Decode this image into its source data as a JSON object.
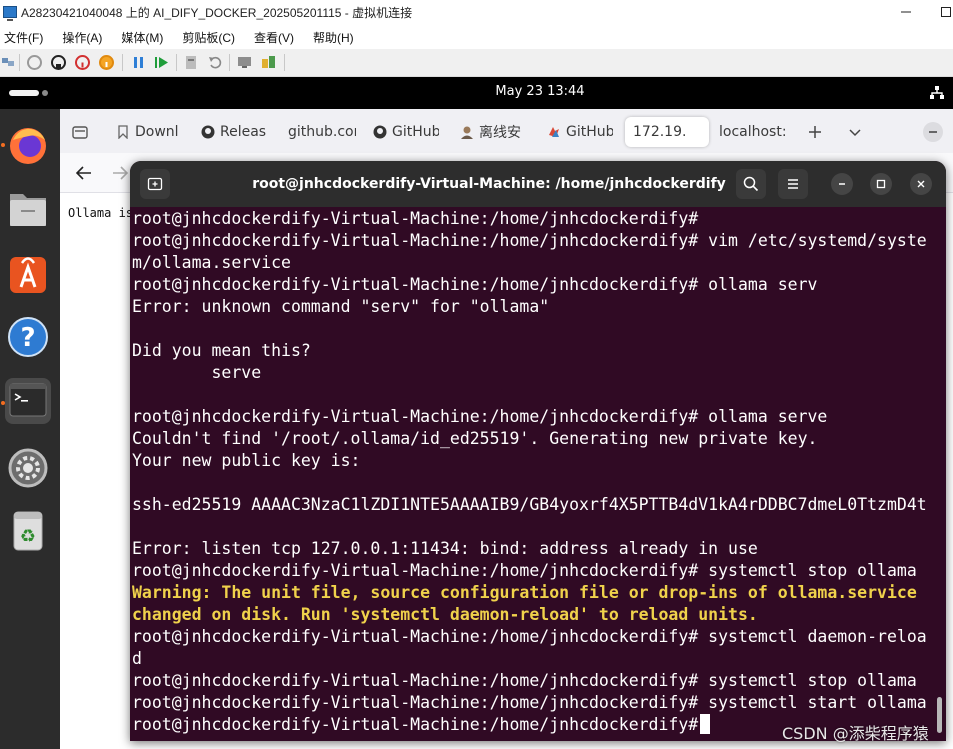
{
  "host_window": {
    "title": "A28230421040048 上的 AI_DIFY_DOCKER_202505201115 - 虚拟机连接",
    "menu": [
      "文件(F)",
      "操作(A)",
      "媒体(M)",
      "剪贴板(C)",
      "查看(V)",
      "帮助(H)"
    ],
    "toolbar_icons": [
      "ctrl-alt-del-icon",
      "start-icon",
      "turn-off-icon",
      "shutdown-icon",
      "power-icon",
      "pause-icon",
      "resume-icon",
      "checkpoint-icon",
      "revert-icon",
      "enhanced-session-icon",
      "share-icon"
    ]
  },
  "ubuntu_topbar": {
    "clock": "May 23  13:44"
  },
  "dock": {
    "apps": [
      "firefox-icon",
      "files-icon",
      "app-center-icon",
      "help-icon",
      "terminal-icon",
      "settings-icon",
      "trash-icon"
    ]
  },
  "firefox": {
    "tabs": [
      {
        "label": "Downl",
        "icon": "download-icon"
      },
      {
        "label": "Releas",
        "icon": "github-icon"
      },
      {
        "label": "github.cor",
        "icon": ""
      },
      {
        "label": "GitHub",
        "icon": "github-icon"
      },
      {
        "label": "离线安",
        "icon": "avatar-icon"
      },
      {
        "label": "GitHub",
        "icon": "gitee-icon"
      },
      {
        "label": "172.19.",
        "icon": ""
      },
      {
        "label": "localhost:",
        "icon": ""
      }
    ],
    "page_text": "Ollama is"
  },
  "terminal": {
    "title": "root@jnhcdockerdify-Virtual-Machine: /home/jnhcdockerdify",
    "lines": [
      {
        "text": "root@jnhcdockerdify-Virtual-Machine:/home/jnhcdockerdify#",
        "style": "normal"
      },
      {
        "text": "root@jnhcdockerdify-Virtual-Machine:/home/jnhcdockerdify# vim /etc/systemd/syste",
        "style": "normal"
      },
      {
        "text": "m/ollama.service",
        "style": "normal"
      },
      {
        "text": "root@jnhcdockerdify-Virtual-Machine:/home/jnhcdockerdify# ollama serv",
        "style": "normal"
      },
      {
        "text": "Error: unknown command \"serv\" for \"ollama\"",
        "style": "normal"
      },
      {
        "text": "",
        "style": "normal"
      },
      {
        "text": "Did you mean this?",
        "style": "normal"
      },
      {
        "text": "        serve",
        "style": "normal"
      },
      {
        "text": "",
        "style": "normal"
      },
      {
        "text": "root@jnhcdockerdify-Virtual-Machine:/home/jnhcdockerdify# ollama serve",
        "style": "normal"
      },
      {
        "text": "Couldn't find '/root/.ollama/id_ed25519'. Generating new private key.",
        "style": "normal"
      },
      {
        "text": "Your new public key is:",
        "style": "normal"
      },
      {
        "text": "",
        "style": "normal"
      },
      {
        "text": "ssh-ed25519 AAAAC3NzaC1lZDI1NTE5AAAAIB9/GB4yoxrf4X5PTTB4dV1kA4rDDBC7dmeL0TtzmD4t",
        "style": "normal"
      },
      {
        "text": "",
        "style": "normal"
      },
      {
        "text": "Error: listen tcp 127.0.0.1:11434: bind: address already in use",
        "style": "normal"
      },
      {
        "text": "root@jnhcdockerdify-Virtual-Machine:/home/jnhcdockerdify# systemctl stop ollama",
        "style": "normal"
      },
      {
        "text": "Warning: The unit file, source configuration file or drop-ins of ollama.service",
        "style": "warn"
      },
      {
        "text": "changed on disk. Run 'systemctl daemon-reload' to reload units.",
        "style": "warn"
      },
      {
        "text": "root@jnhcdockerdify-Virtual-Machine:/home/jnhcdockerdify# systemctl daemon-reloa",
        "style": "normal"
      },
      {
        "text": "d",
        "style": "normal"
      },
      {
        "text": "root@jnhcdockerdify-Virtual-Machine:/home/jnhcdockerdify# systemctl stop ollama",
        "style": "normal"
      },
      {
        "text": "root@jnhcdockerdify-Virtual-Machine:/home/jnhcdockerdify# systemctl start ollama",
        "style": "normal"
      }
    ],
    "prompt": "root@jnhcdockerdify-Virtual-Machine:/home/jnhcdockerdify#"
  },
  "watermark": "CSDN @添柴程序猿",
  "colors": {
    "terminal_bg": "#300a24",
    "terminal_header": "#2d2d2d",
    "warning_text": "#f0d24b",
    "dock_bg": "#2c2c2c",
    "topbar_bg": "#000000"
  }
}
